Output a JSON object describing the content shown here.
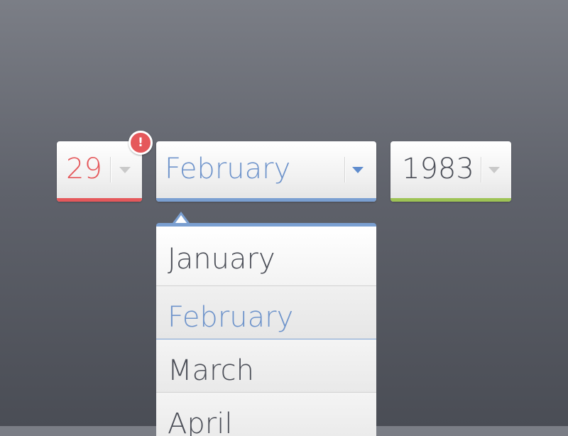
{
  "date_picker": {
    "day": {
      "value": "29",
      "status": "error",
      "accent_color": "#e5585b",
      "arrow_icon": "chevron-down-icon"
    },
    "error_badge": {
      "symbol": "!",
      "icon": "exclamation-icon",
      "color": "#e5585b"
    },
    "month": {
      "value": "February",
      "status": "open",
      "accent_color": "#7a9fd1",
      "arrow_icon": "chevron-down-icon"
    },
    "year": {
      "value": "1983",
      "status": "valid",
      "accent_color": "#9ec355",
      "arrow_icon": "chevron-down-icon"
    },
    "month_dropdown": {
      "options": [
        {
          "label": "January"
        },
        {
          "label": "February",
          "selected": true
        },
        {
          "label": "March"
        },
        {
          "label": "April"
        }
      ]
    }
  }
}
